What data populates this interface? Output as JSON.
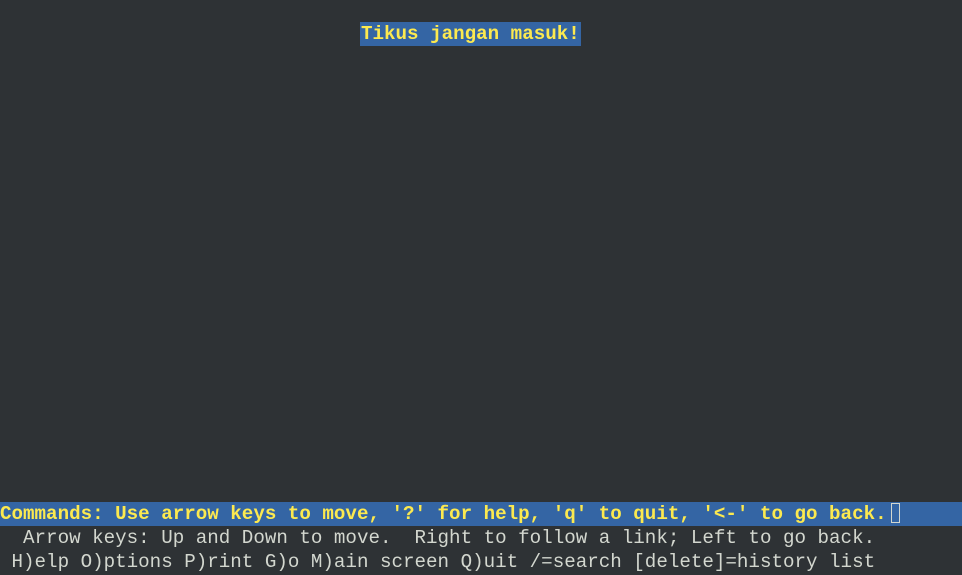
{
  "page": {
    "title": "Tikus jangan masuk!"
  },
  "status": {
    "commands": "Commands: Use arrow keys to move, '?' for help, 'q' to quit, '<-' to go back."
  },
  "help": {
    "line1": "  Arrow keys: Up and Down to move.  Right to follow a link; Left to go back.",
    "line2": " H)elp O)ptions P)rint G)o M)ain screen Q)uit /=search [delete]=history list"
  },
  "colors": {
    "background": "#2e3235",
    "highlight_bg": "#3465a4",
    "highlight_fg": "#fce94f",
    "text": "#d3d7cf"
  }
}
